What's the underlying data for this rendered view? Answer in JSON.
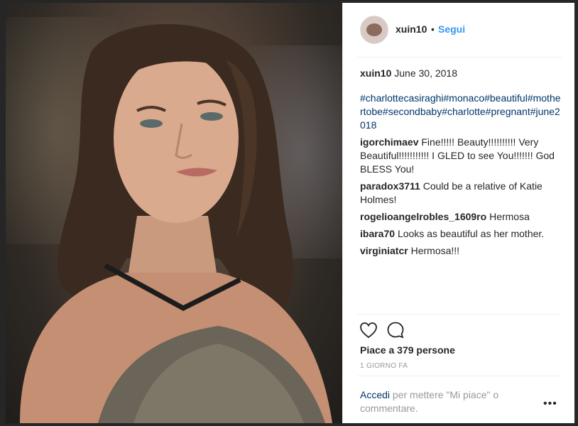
{
  "post": {
    "username": "xuin10",
    "dot": "•",
    "follow_label": "Segui",
    "date": "June 30, 2018",
    "hashtags": "#charlottecasiraghi#monaco#beautiful#mothertobe#secondbaby#charlotte#pregnant#june2018",
    "comments": [
      {
        "user": "igorchimaev",
        "text": "Fine!!!!! Beauty!!!!!!!!!! Very Beautiful!!!!!!!!!!! I GLED to see You!!!!!!! God BLESS You!"
      },
      {
        "user": "paradox3711",
        "text": "Could be a relative of Katie Holmes!"
      },
      {
        "user": "rogelioangelrobles_1609ro",
        "text": "Hermosa"
      },
      {
        "user": "ibara70",
        "text": "Looks as beautiful as her mother."
      },
      {
        "user": "virginiatcr",
        "text": "Hermosa!!!"
      }
    ],
    "likes": "Piace a 379 persone",
    "time": "1 GIORNO FA",
    "login_link": "Accedi",
    "login_text": "per mettere \"Mi piace\" o commentare.",
    "more": "•••"
  },
  "icons": {
    "heart": "heart-icon",
    "comment": "comment-icon",
    "more": "more-options-icon"
  },
  "colors": {
    "link_blue": "#3897f0",
    "hashtag_blue": "#003569",
    "text": "#262626",
    "muted": "#999999"
  }
}
